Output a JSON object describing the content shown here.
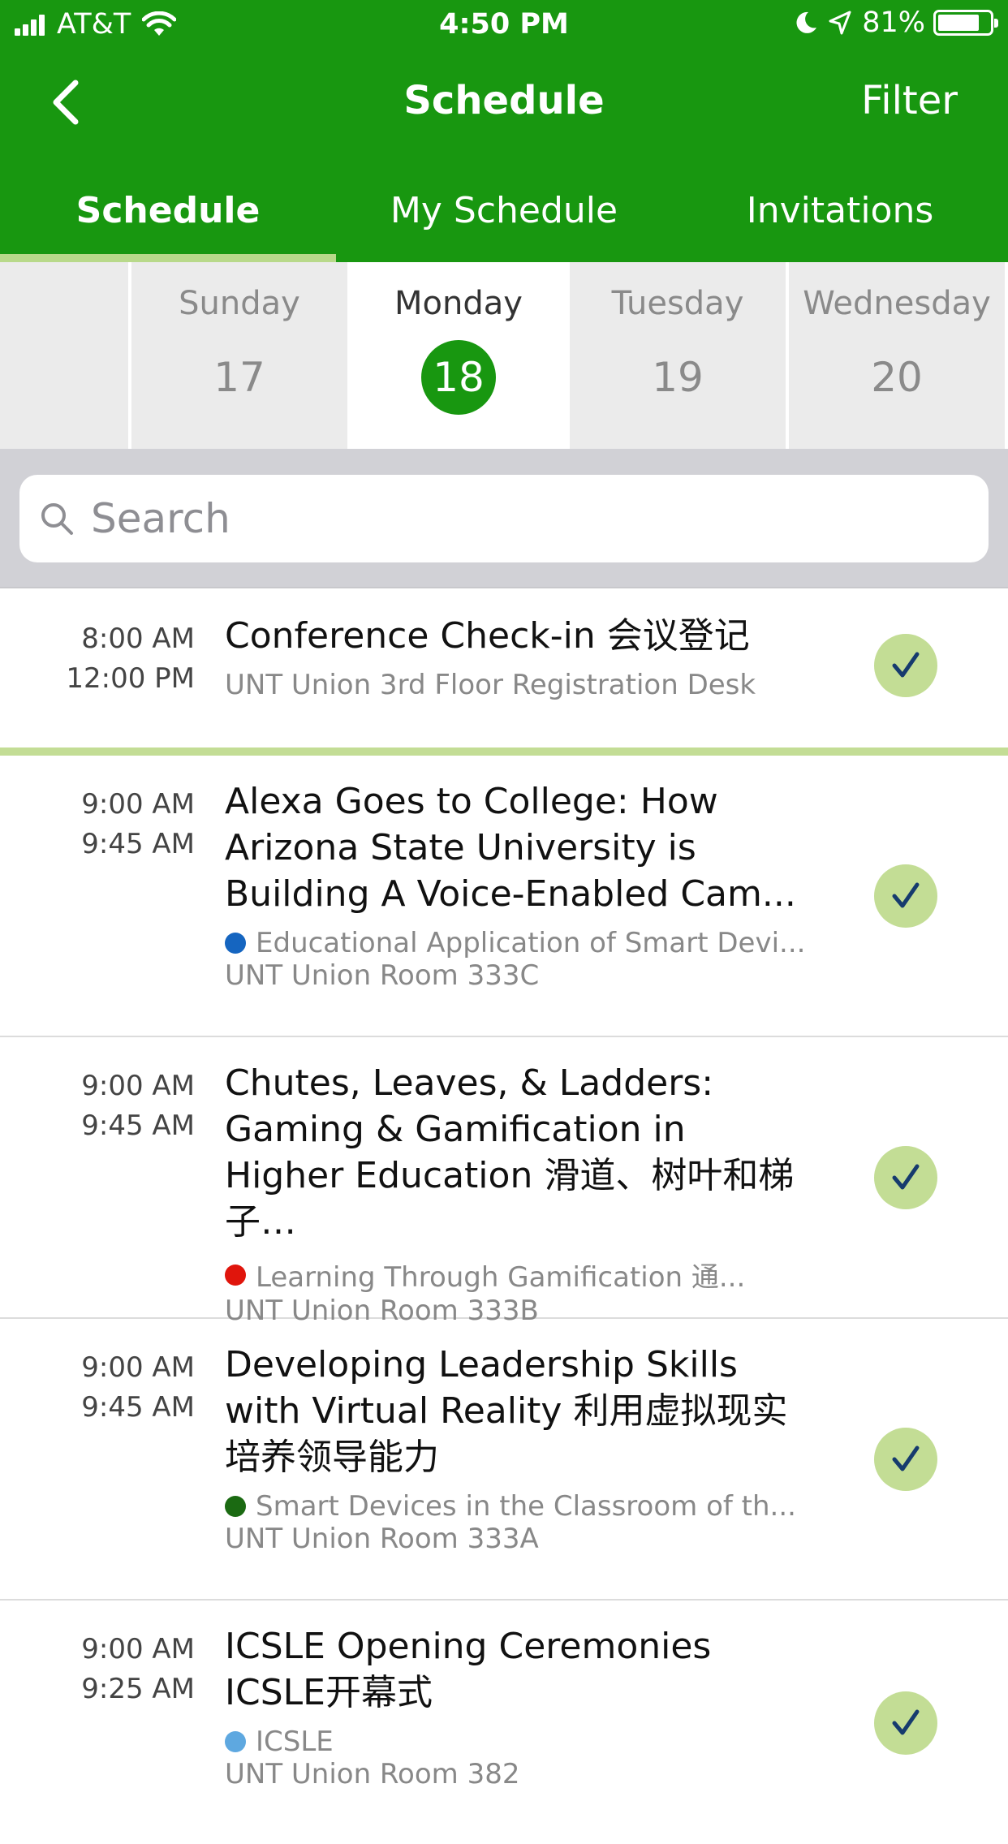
{
  "status_bar": {
    "carrier": "AT&T",
    "time": "4:50 PM",
    "battery": "81%",
    "battery_level": 0.81
  },
  "nav": {
    "title": "Schedule",
    "filter_label": "Filter"
  },
  "tabs": [
    {
      "label": "Schedule",
      "active": true
    },
    {
      "label": "My Schedule",
      "active": false
    },
    {
      "label": "Invitations",
      "active": false
    }
  ],
  "days": [
    {
      "name": "Sunday",
      "number": "17",
      "selected": false
    },
    {
      "name": "Monday",
      "number": "18",
      "selected": true
    },
    {
      "name": "Tuesday",
      "number": "19",
      "selected": false
    },
    {
      "name": "Wednesday",
      "number": "20",
      "selected": false
    }
  ],
  "search": {
    "placeholder": "Search"
  },
  "sessions": [
    {
      "start": "8:00 AM",
      "end": "12:00 PM",
      "title": "Conference Check-in 会议登记",
      "track": "",
      "track_color": "",
      "room": "UNT Union 3rd Floor Registration Desk",
      "added": true
    },
    {
      "start": "9:00 AM",
      "end": "9:45 AM",
      "title": "Alexa Goes to College: How Arizona State University is Building A Voice-Enabled Cam...",
      "track": "Educational Application of Smart Devi...",
      "track_color": "#1565c0",
      "room": "UNT Union Room 333C",
      "added": true
    },
    {
      "start": "9:00 AM",
      "end": "9:45 AM",
      "title": "Chutes, Leaves, & Ladders: Gaming & Gamification in Higher Education 滑道、树叶和梯子…",
      "track": "Learning Through Gamification       通...",
      "track_color": "#e0150c",
      "room": "UNT Union Room 333B",
      "added": true
    },
    {
      "start": "9:00 AM",
      "end": "9:45 AM",
      "title": "Developing Leadership Skills with Virtual Reality 利用虚拟现实培养领导能力",
      "track": "Smart Devices in the Classroom of th...",
      "track_color": "#1b6a12",
      "room": "UNT Union Room 333A",
      "added": true
    },
    {
      "start": "9:00 AM",
      "end": "9:25 AM",
      "title": "ICSLE Opening Ceremonies ICSLE开幕式",
      "track": "ICSLE",
      "track_color": "#5ea8e0",
      "room": "UNT Union Room 382",
      "added": true
    }
  ],
  "colors": {
    "header_green": "#189710",
    "check_circle": "#c3dd95",
    "check_mark": "#163b6e"
  }
}
